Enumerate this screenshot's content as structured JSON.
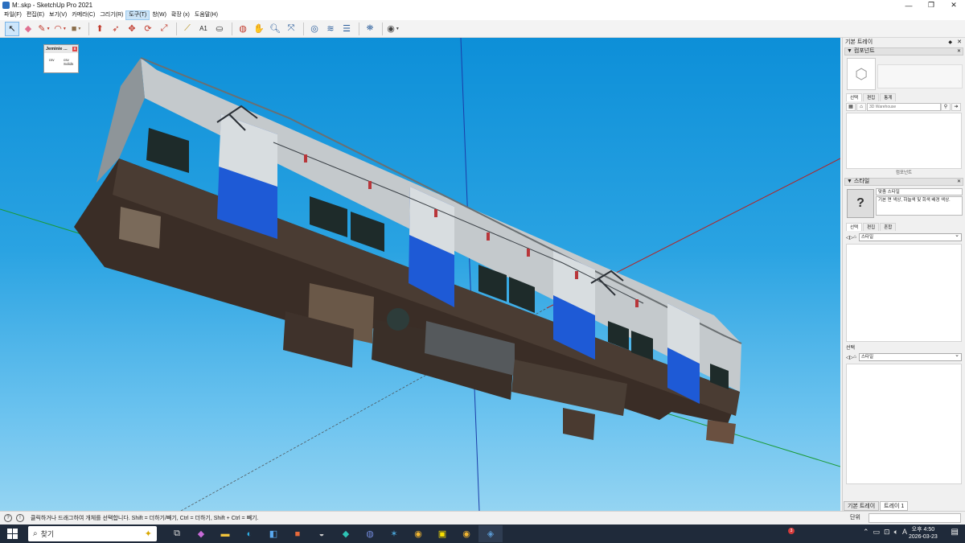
{
  "window": {
    "title": "M:.skp - SketchUp Pro 2021",
    "minimize": "—",
    "maximize": "❐",
    "close": "✕"
  },
  "menu": [
    "파일(F)",
    "편집(E)",
    "보기(V)",
    "카메라(C)",
    "그리기(R)",
    "도구(T)",
    "창(W)",
    "확장 (x)",
    "도움말(H)"
  ],
  "menu_active_index": 5,
  "plugin_window": {
    "title": "Jeminie ...",
    "buttons": [
      "csv",
      "csv"
    ],
    "sublabel": "Solids"
  },
  "default_tray": {
    "title": "기본 트레이",
    "components": {
      "header": "컴포넌트",
      "tabs": [
        "선택",
        "편집",
        "통계"
      ],
      "search_placeholder": "3D Warehouse",
      "footer": "컴포넌트"
    },
    "styles": {
      "header": "스타일",
      "style_name": "맞춤 스타일",
      "style_desc": "기본 면 색상, 하늘색 및 회색 배경 색상.",
      "tabs": [
        "선택",
        "편집",
        "혼합"
      ],
      "select_value": "스타일",
      "mix_label": "선택",
      "mix_select_value": "스타일"
    },
    "bottom_tabs": [
      "기본 트레이",
      "트레이 1"
    ]
  },
  "status": {
    "message": "클릭하거나 드래그하여 개체를 선택합니다. Shift = 더하기/빼기, Ctrl = 더하기, Shift + Ctrl = 빼기.",
    "unit_label": "단위"
  },
  "taskbar": {
    "search_text": "찾기",
    "notification_count": "3",
    "time": "오후 4:50",
    "date": "2026-03-23",
    "ime": "A"
  },
  "colors": {
    "sky_top": "#0d8fd8",
    "sky_bottom": "#94d4f2",
    "taskbar": "#1f2a3a",
    "active_tool": "#cde6fb"
  }
}
